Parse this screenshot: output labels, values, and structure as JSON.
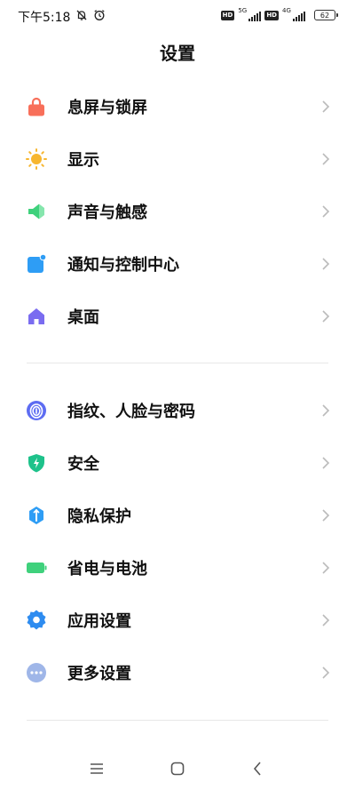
{
  "status_bar": {
    "time": "下午5:18",
    "network_1": "5G",
    "network_2": "4G",
    "hd_1": "HD",
    "hd_2": "HD",
    "battery": "62"
  },
  "header": {
    "title": "设置"
  },
  "settings": {
    "items": [
      {
        "label": "息屏与锁屏",
        "icon": "lock-icon",
        "color": "#f86f5a"
      },
      {
        "label": "显示",
        "icon": "sun-icon",
        "color": "#f7b62f"
      },
      {
        "label": "声音与触感",
        "icon": "speaker-icon",
        "color": "#3fd17c"
      },
      {
        "label": "通知与控制中心",
        "icon": "notification-icon",
        "color": "#2e9df5"
      },
      {
        "label": "桌面",
        "icon": "home-icon",
        "color": "#7a6cf0"
      },
      {
        "label": "指纹、人脸与密码",
        "icon": "fingerprint-icon",
        "color": "#5d6cf2"
      },
      {
        "label": "安全",
        "icon": "shield-icon",
        "color": "#1ec28b"
      },
      {
        "label": "隐私保护",
        "icon": "privacy-icon",
        "color": "#2e9df5"
      },
      {
        "label": "省电与电池",
        "icon": "battery-icon",
        "color": "#3fd17c"
      },
      {
        "label": "应用设置",
        "icon": "gear-icon",
        "color": "#2e8cf0"
      },
      {
        "label": "更多设置",
        "icon": "more-icon",
        "color": "#9fb6e8"
      }
    ]
  },
  "nav": {
    "menu_icon": "menu-icon",
    "home_icon": "home-square-icon",
    "back_icon": "back-icon"
  }
}
